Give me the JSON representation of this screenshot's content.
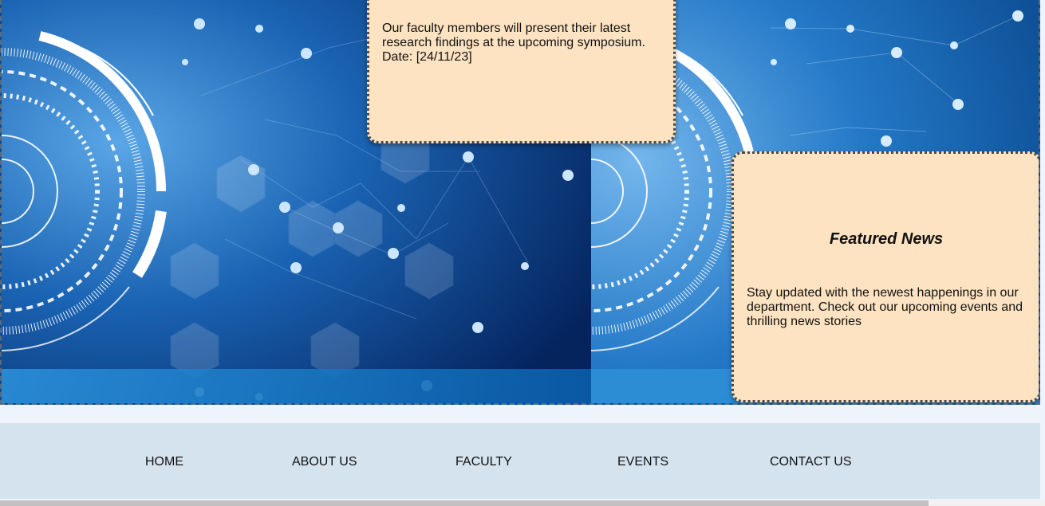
{
  "hero": {
    "image": "tech-network-banner"
  },
  "cards": {
    "top": {
      "text": "Our faculty members will present their latest research findings at the upcoming symposium. Date: [24/11/23]"
    },
    "featured": {
      "title": "Featured News",
      "text": "Stay updated with the newest happenings in our department. Check out our upcoming events and thrilling news stories"
    }
  },
  "nav": {
    "items": [
      {
        "label": "HOME"
      },
      {
        "label": "ABOUT US"
      },
      {
        "label": "FACULTY"
      },
      {
        "label": "EVENTS"
      },
      {
        "label": "CONTACT US"
      }
    ]
  },
  "colors": {
    "card_bg": "#fde3c1",
    "nav_bg": "#d5e3ee",
    "hero_blue": "#0d4c92"
  }
}
